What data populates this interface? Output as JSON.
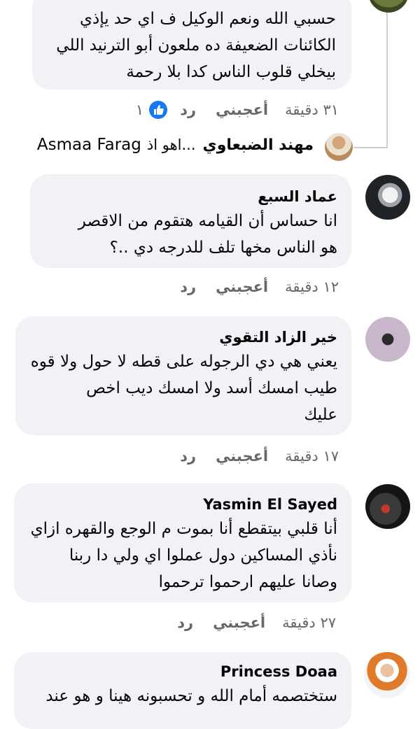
{
  "comment_top": {
    "lines": [
      "حسبي الله ونعم الوكيل ف اي حد يإذي",
      "الكائنات الضعيفة ده ملعون أبو الترنيد اللي",
      "بيخلي قلوب الناس كدا بلا رحمة"
    ],
    "time": "٣١ دقيقة",
    "like_label": "أعجبني",
    "reply_label": "رد",
    "reaction_count": "١"
  },
  "reply_preview": {
    "author": "مهند الضبعاوي",
    "snippet": "...اهو اذ",
    "mention": "Asmaa Farag"
  },
  "comments": [
    {
      "author": "عماد السبع",
      "lines": [
        "انا حساس أن القيامه هتقوم من الاقصر",
        "هو الناس مخها تلف للدرجه دي ..؟"
      ],
      "time": "١٢ دقيقة",
      "like_label": "أعجبني",
      "reply_label": "رد"
    },
    {
      "author": "خير الزاد التقوي",
      "lines": [
        "يعني هي دي الرجوله على قطه لا حول ولا قوه",
        "طيب امسك أسد ولا امسك ديب اخص",
        "عليك"
      ],
      "time": "١٧ دقيقة",
      "like_label": "أعجبني",
      "reply_label": "رد"
    },
    {
      "author": "Yasmin El Sayed",
      "lines": [
        "أنا قلبي بيتقطع أنا بموت م الوجع والقهره ازاي",
        "نأذي المساكين دول عملوا اي ولي دا ربنا",
        "وصانا عليهم ارحموا ترحموا"
      ],
      "time": "٢٧ دقيقة",
      "like_label": "أعجبني",
      "reply_label": "رد"
    },
    {
      "author": "Princess Doaa",
      "lines": [
        "ستختصمه أمام الله و تحسبونه هينا و هو عند"
      ]
    }
  ],
  "colors": {
    "bubble": "#f0f2f5",
    "meta_text": "#65676b",
    "like_blue": "#1877f2"
  }
}
